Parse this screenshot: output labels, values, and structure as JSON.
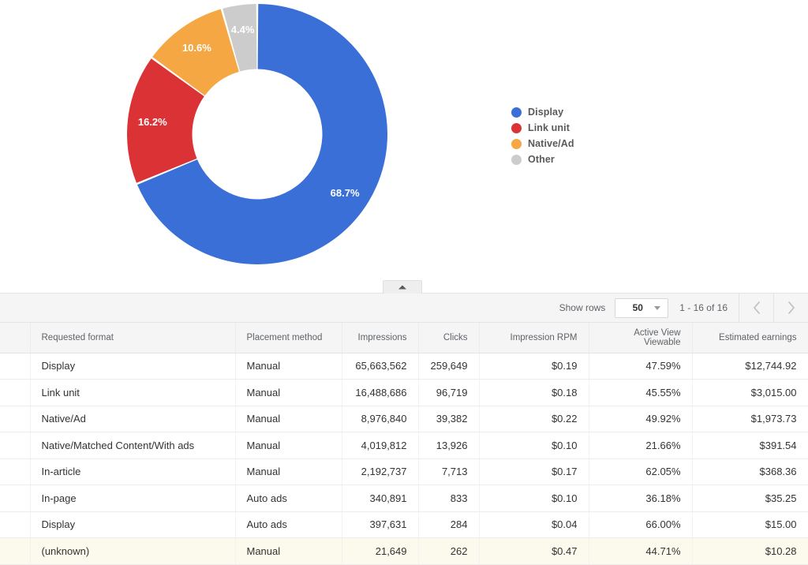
{
  "chart_data": {
    "type": "pie",
    "variant": "donut",
    "title": "",
    "categories": [
      "Display",
      "Link unit",
      "Native/Ad",
      "Other"
    ],
    "values": [
      68.7,
      16.2,
      10.6,
      4.4
    ],
    "value_labels": [
      "68.7%",
      "16.2%",
      "10.6%",
      "4.4%"
    ],
    "unit": "%",
    "colors": [
      "#3a6fd8",
      "#db3236",
      "#f4a742",
      "#cccccc"
    ],
    "legend": {
      "position": "right",
      "entries": [
        {
          "label": "Display",
          "color": "#3a6fd8"
        },
        {
          "label": "Link unit",
          "color": "#db3236"
        },
        {
          "label": "Native/Ad",
          "color": "#f4a742"
        },
        {
          "label": "Other",
          "color": "#cccccc"
        }
      ]
    },
    "label_color": "#ffffff",
    "start_angle_deg": 0,
    "inner_radius_ratio": 0.5
  },
  "collapse_tab": {
    "icon": "caret-up-icon"
  },
  "toolbar": {
    "show_rows_label": "Show rows",
    "rows_value": "50",
    "rows_options": [
      "50"
    ],
    "range_label": "1 - 16 of 16",
    "prev_icon": "chevron-left-icon",
    "next_icon": "chevron-right-icon"
  },
  "table": {
    "columns": [
      {
        "key": "format",
        "label": "Requested format",
        "align": "left"
      },
      {
        "key": "method",
        "label": "Placement method",
        "align": "left"
      },
      {
        "key": "impr",
        "label": "Impressions",
        "align": "right"
      },
      {
        "key": "clicks",
        "label": "Clicks",
        "align": "right"
      },
      {
        "key": "rpm",
        "label": "Impression RPM",
        "align": "right"
      },
      {
        "key": "view",
        "label": "Active View Viewable",
        "align": "right"
      },
      {
        "key": "earn",
        "label": "Estimated earnings",
        "align": "right"
      }
    ],
    "rows": [
      {
        "format": "Display",
        "method": "Manual",
        "impr": "65,663,562",
        "clicks": "259,649",
        "rpm": "$0.19",
        "view": "47.59%",
        "earn": "$12,744.92",
        "highlight": false
      },
      {
        "format": "Link unit",
        "method": "Manual",
        "impr": "16,488,686",
        "clicks": "96,719",
        "rpm": "$0.18",
        "view": "45.55%",
        "earn": "$3,015.00",
        "highlight": false
      },
      {
        "format": "Native/Ad",
        "method": "Manual",
        "impr": "8,976,840",
        "clicks": "39,382",
        "rpm": "$0.22",
        "view": "49.92%",
        "earn": "$1,973.73",
        "highlight": false
      },
      {
        "format": "Native/Matched Content/With ads",
        "method": "Manual",
        "impr": "4,019,812",
        "clicks": "13,926",
        "rpm": "$0.10",
        "view": "21.66%",
        "earn": "$391.54",
        "highlight": false
      },
      {
        "format": "In-article",
        "method": "Manual",
        "impr": "2,192,737",
        "clicks": "7,713",
        "rpm": "$0.17",
        "view": "62.05%",
        "earn": "$368.36",
        "highlight": false
      },
      {
        "format": "In-page",
        "method": "Auto ads",
        "impr": "340,891",
        "clicks": "833",
        "rpm": "$0.10",
        "view": "36.18%",
        "earn": "$35.25",
        "highlight": false
      },
      {
        "format": "Display",
        "method": "Auto ads",
        "impr": "397,631",
        "clicks": "284",
        "rpm": "$0.04",
        "view": "66.00%",
        "earn": "$15.00",
        "highlight": false
      },
      {
        "format": "(unknown)",
        "method": "Manual",
        "impr": "21,649",
        "clicks": "262",
        "rpm": "$0.47",
        "view": "44.71%",
        "earn": "$10.28",
        "highlight": true
      }
    ]
  }
}
